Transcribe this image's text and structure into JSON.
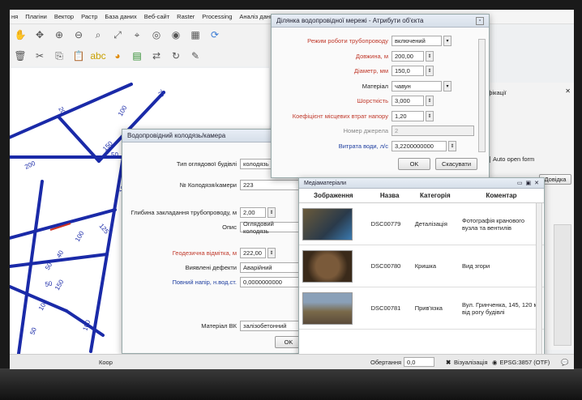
{
  "menu": [
    "ня",
    "Плагіни",
    "Вектор",
    "Растр",
    "База даних",
    "Веб-сайт",
    "Raster",
    "Processing",
    "Аналіз даних"
  ],
  "map": {
    "labels": [
      "200",
      "75",
      "20",
      "100",
      "150",
      "50",
      "100",
      "125",
      "100",
      "40",
      "50",
      "50",
      "150",
      "100",
      "50",
      "100"
    ]
  },
  "attr_dialog": {
    "title": "Ділянка водопровідної мережі - Атрибути об'єкта",
    "fields": [
      {
        "label": "Режим роботи трубопроводу",
        "value": "включений",
        "type": "select",
        "color": "red"
      },
      {
        "label": "Довжина, м",
        "value": "200,00",
        "type": "spin",
        "color": "red"
      },
      {
        "label": "Діаметр, мм",
        "value": "150,0",
        "type": "spin",
        "color": "red"
      },
      {
        "label": "Матеріал",
        "value": "чавун",
        "type": "select",
        "color": "black"
      },
      {
        "label": "Шорсткість",
        "value": "3,000",
        "type": "spin",
        "color": "red"
      },
      {
        "label": "Коефіцієнт місцевих втрат напору",
        "value": "1,20",
        "type": "spin",
        "color": "red"
      },
      {
        "label": "Номер джерела",
        "value": "2",
        "type": "text",
        "color": "gray"
      },
      {
        "label": "Витрата води, л/с",
        "value": "3,2200000000",
        "type": "spin",
        "color": "blue"
      }
    ],
    "ok": "OK",
    "cancel": "Скасувати"
  },
  "well_dialog": {
    "title": "Водопровідний колодязь/камера",
    "fields": [
      {
        "label": "Тип оглядової будівлі",
        "value": "колодязь",
        "color": "black"
      },
      {
        "label": "№ Колодязя/камери",
        "value": "223",
        "color": "black"
      },
      {
        "label": "Глибина закладання трубопроводу, м",
        "value": "2,00",
        "color": "black"
      },
      {
        "label": "Опис",
        "value": "Оглядовий колодязь",
        "color": "black"
      },
      {
        "label": "Геодезична відмітка, м",
        "value": "222,00",
        "color": "red"
      },
      {
        "label": "Виявлені дефекти",
        "value": "Аварійний",
        "color": "black"
      },
      {
        "label": "Повний напір, н.вод.ст.",
        "value": "0,0000000000",
        "color": "blue"
      },
      {
        "label": "Матеріал ВК",
        "value": "залізобетонний",
        "color": "black"
      }
    ],
    "ok": "OK"
  },
  "media": {
    "title": "Медіаматеріали",
    "columns": [
      "Зображення",
      "Назва",
      "Категорія",
      "Коментар"
    ],
    "rows": [
      {
        "name": "DSC00779",
        "category": "Деталізація",
        "comment": "Фотографія кранового вузла та вентилів"
      },
      {
        "name": "DSC00780",
        "category": "Кришка",
        "comment": "Вид згори"
      },
      {
        "name": "DSC00781",
        "category": "Прив'язка",
        "comment": "Вул. Гринченка, 145, 120 м від рогу будівлі"
      }
    ]
  },
  "right_panel": {
    "title": "ифікації",
    "auto_open": "Auto open form",
    "help": "Довідка"
  },
  "status": {
    "coord_label": "Коор",
    "rotation_label": "Обертання",
    "rotation_value": "0,0",
    "render_label": "Візуалізація",
    "crs": "EPSG:3857 (OTF)"
  }
}
